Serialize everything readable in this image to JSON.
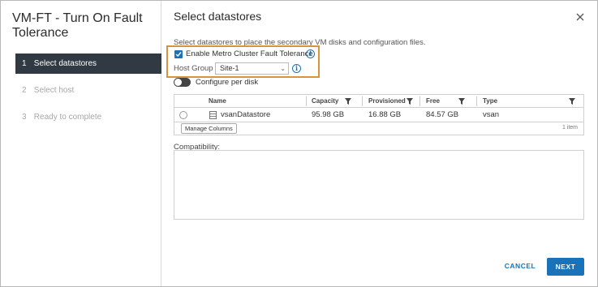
{
  "wizard": {
    "title": "VM-FT - Turn On Fault Tolerance",
    "steps": [
      {
        "num": "1",
        "label": "Select datastores"
      },
      {
        "num": "2",
        "label": "Select host"
      },
      {
        "num": "3",
        "label": "Ready to complete"
      }
    ],
    "active_step": 0
  },
  "page": {
    "title": "Select datastores",
    "subtitle": "Select datastores to place the secondary VM disks and configuration files.",
    "close_icon": "close-icon"
  },
  "fault_tolerance": {
    "checkbox_label": "Enable Metro Cluster Fault Tolerance",
    "checked": true,
    "host_group_label": "Host Group",
    "host_group_value": "Site-1"
  },
  "configure_per_disk": {
    "label": "Configure per disk",
    "on": false
  },
  "grid": {
    "columns": [
      "Name",
      "Capacity",
      "Provisioned",
      "Free",
      "Type"
    ],
    "rows": [
      {
        "name": "vsanDatastore",
        "capacity": "95.98 GB",
        "provisioned": "16.88 GB",
        "free": "84.57 GB",
        "type": "vsan"
      }
    ],
    "manage_columns_label": "Manage Columns",
    "count_label": "1 item"
  },
  "compatibility": {
    "label": "Compatibility:"
  },
  "footer": {
    "cancel_label": "CANCEL",
    "next_label": "NEXT"
  },
  "colors": {
    "accent": "#1a73b8",
    "active_step_bg": "#313a42",
    "highlight": "#d8943a"
  }
}
